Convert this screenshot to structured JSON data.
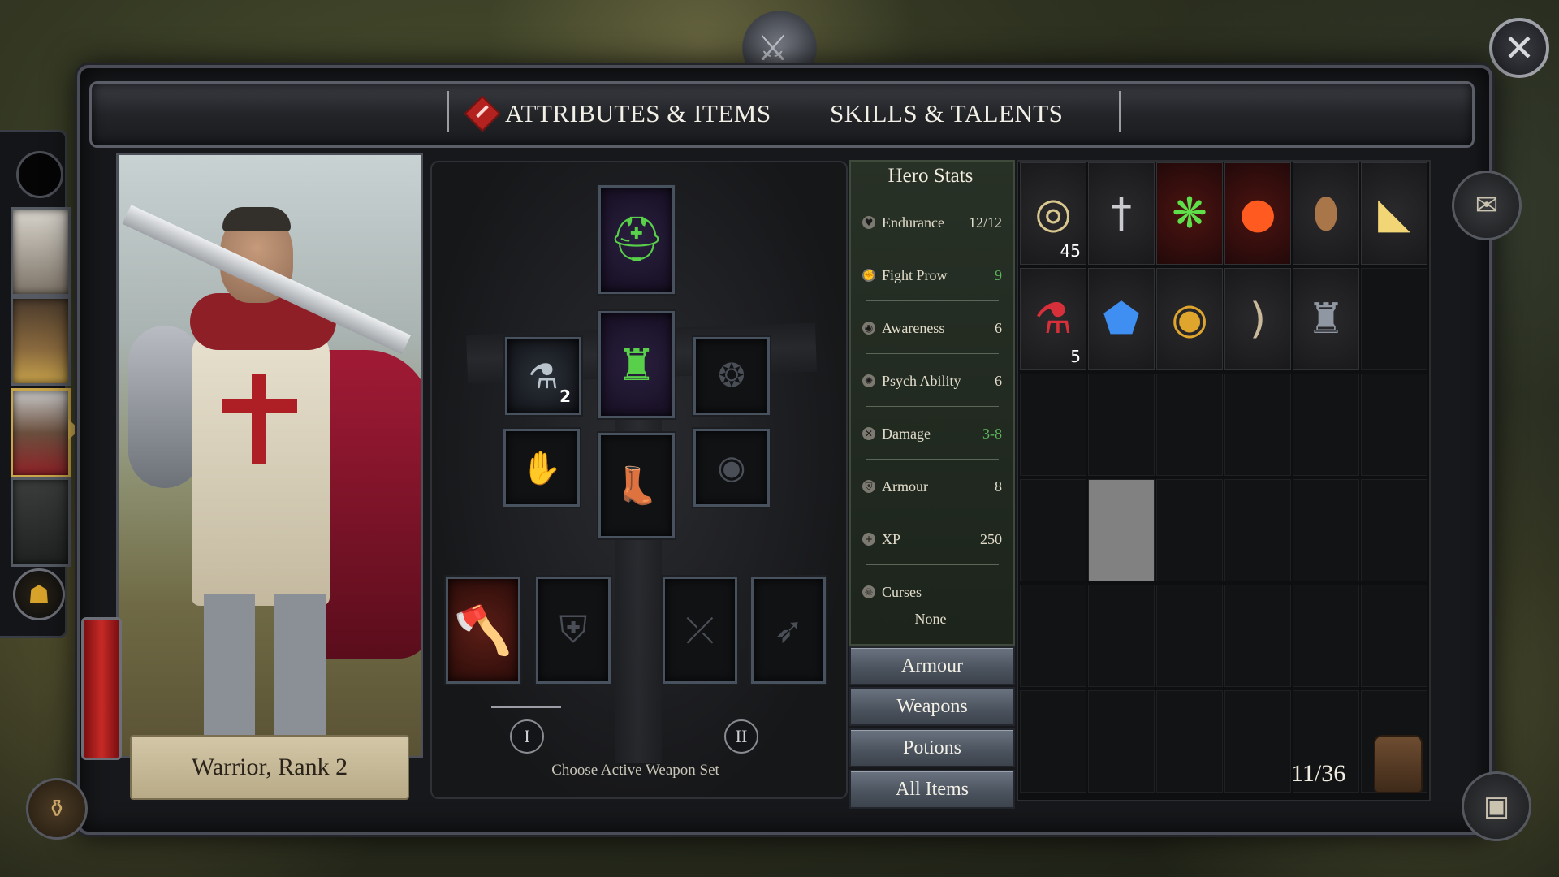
{
  "tabs": [
    {
      "label": "ATTRIBUTES & ITEMS",
      "active": true
    },
    {
      "label": "SKILLS & TALENTS",
      "active": false
    }
  ],
  "hero": {
    "name_rank": "Warrior, Rank 2"
  },
  "stats": {
    "title": "Hero Stats",
    "rows": [
      {
        "label": "Endurance",
        "value": "12/12",
        "icon": "heart-shield-icon"
      },
      {
        "label": "Fight Prow",
        "value": "9",
        "icon": "fist-icon",
        "accent": "#5db55a"
      },
      {
        "label": "Awareness",
        "value": "6",
        "icon": "eye-icon"
      },
      {
        "label": "Psych Ability",
        "value": "6",
        "icon": "brain-icon"
      },
      {
        "label": "Damage",
        "value": "3-8",
        "icon": "crossed-swords-icon",
        "accent": "#5db55a"
      },
      {
        "label": "Armour",
        "value": "8",
        "icon": "shield-icon"
      },
      {
        "label": "XP",
        "value": "250",
        "icon": "plus-icon"
      },
      {
        "label": "Curses",
        "value": "",
        "icon": "skull-icon"
      }
    ],
    "curses_value": "None"
  },
  "filters": [
    "Armour",
    "Weapons",
    "Potions",
    "All Items"
  ],
  "equipment": {
    "potion_count": "2",
    "weapon_sets": [
      "I",
      "II"
    ],
    "choose_label": "Choose Active Weapon Set"
  },
  "inventory": {
    "count": "11/36",
    "items": [
      {
        "name": "coins-icon",
        "qty": "45"
      },
      {
        "name": "dagger-icon",
        "qty": ""
      },
      {
        "name": "green-rune-icon",
        "qty": ""
      },
      {
        "name": "fire-orb-icon",
        "qty": ""
      },
      {
        "name": "bread-icon",
        "qty": ""
      },
      {
        "name": "cheese-icon",
        "qty": ""
      },
      {
        "name": "red-potion-icon",
        "qty": "5"
      },
      {
        "name": "blue-gem-icon",
        "qty": ""
      },
      {
        "name": "gold-coin-icon",
        "qty": ""
      },
      {
        "name": "bow-icon",
        "qty": ""
      },
      {
        "name": "chainmail-icon",
        "qty": ""
      }
    ]
  },
  "colors": {
    "accent_green": "#5db55a",
    "filter_button": "#4a525d",
    "active_tab_icon": "#b3221f"
  }
}
